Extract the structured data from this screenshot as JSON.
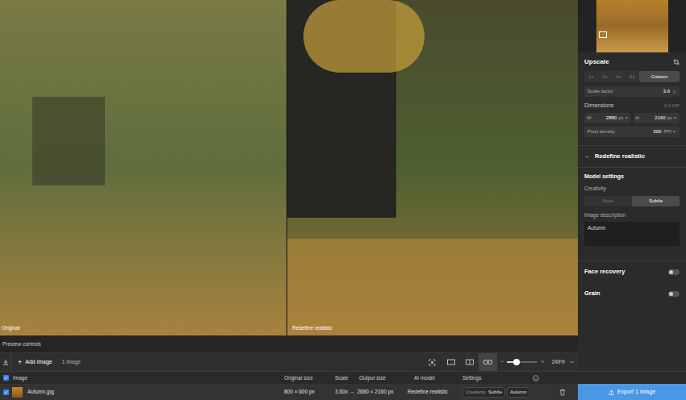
{
  "preview": {
    "left_label": "Original",
    "right_label": "Redefine realistic"
  },
  "preview_controls": {
    "label": "Preview controls"
  },
  "toolbar": {
    "add_icon": "+",
    "add_button": "Add image",
    "image_count": "1 image",
    "view_modes": [
      {
        "selected": false
      },
      {
        "selected": false
      },
      {
        "selected": false
      },
      {
        "selected": true
      }
    ],
    "zoom": {
      "minus": "−",
      "plus": "+",
      "level": 0.3,
      "reading": "249%"
    }
  },
  "sidebar": {
    "upscale": {
      "title": "Upscale",
      "scale_options": [
        {
          "label": "1x",
          "selected": false
        },
        {
          "label": "2x",
          "selected": false
        },
        {
          "label": "4x",
          "selected": false
        },
        {
          "label": "6x",
          "selected": false
        },
        {
          "label": "Custom",
          "selected": true
        }
      ],
      "scale_factor": {
        "label": "Scale factor",
        "value": "3.6"
      },
      "dimensions": {
        "label": "Dimensions",
        "megapixels": "6.2 MP",
        "width": {
          "label": "W",
          "value": "2880",
          "unit": "px"
        },
        "height": {
          "label": "H",
          "value": "2160",
          "unit": "px"
        }
      },
      "pixel_density": {
        "label": "Pixel density",
        "value": "300",
        "unit": "PPI"
      }
    },
    "model": {
      "back": "←",
      "title": "Redefine realistic",
      "settings_label": "Model settings",
      "creativity": {
        "label": "Creativity",
        "options": [
          {
            "label": "None",
            "selected": false
          },
          {
            "label": "Subtle",
            "selected": true
          }
        ]
      },
      "description": {
        "label": "Image description",
        "value": "Autumn"
      }
    },
    "toggles": [
      {
        "label": "Face recovery",
        "on": false
      },
      {
        "label": "Grain",
        "on": false
      }
    ]
  },
  "table": {
    "all_checked": true,
    "columns": [
      "Image",
      "Original size",
      "Scale",
      "Output size",
      "AI model",
      "Settings"
    ],
    "rows": [
      {
        "checked": true,
        "name": "Autumn.jpg",
        "original_size": "800 × 600 px",
        "scale": "3.60x",
        "arrow": "→",
        "output_size": "2880 × 2160 px",
        "model": "Redefine realistic",
        "settings": {
          "creativity_label": "Creativity",
          "creativity": "Subtle",
          "description": "Autumn"
        }
      }
    ]
  },
  "export": {
    "label": "Export 1 image"
  }
}
